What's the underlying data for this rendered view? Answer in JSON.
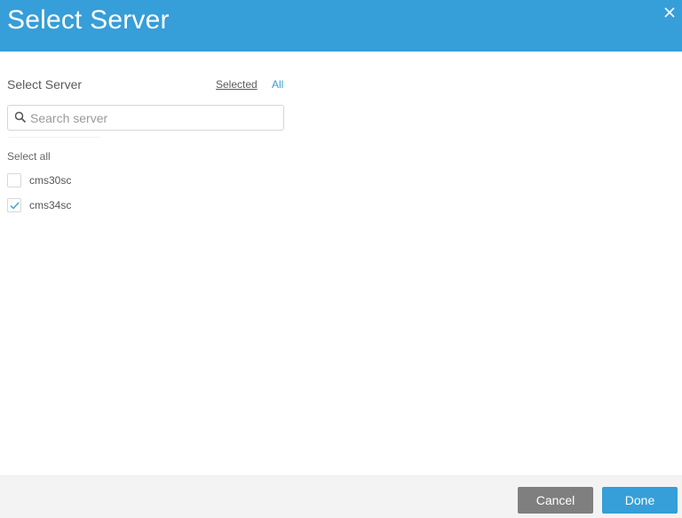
{
  "dialog": {
    "title": "Select Server",
    "close_icon": "close-icon"
  },
  "selector": {
    "label": "Select Server",
    "filters": {
      "selected": "Selected",
      "all": "All",
      "active": "all"
    },
    "search": {
      "value": "",
      "placeholder": "Search server",
      "icon": "search-icon"
    },
    "select_all_label": "Select all",
    "servers": [
      {
        "name": "cms30sc",
        "checked": false
      },
      {
        "name": "cms34sc",
        "checked": true
      }
    ]
  },
  "footer": {
    "cancel_label": "Cancel",
    "done_label": "Done"
  },
  "colors": {
    "accent": "#369ed8",
    "cancel": "#7f7f7f",
    "footer_bg": "#f3f3f3"
  }
}
